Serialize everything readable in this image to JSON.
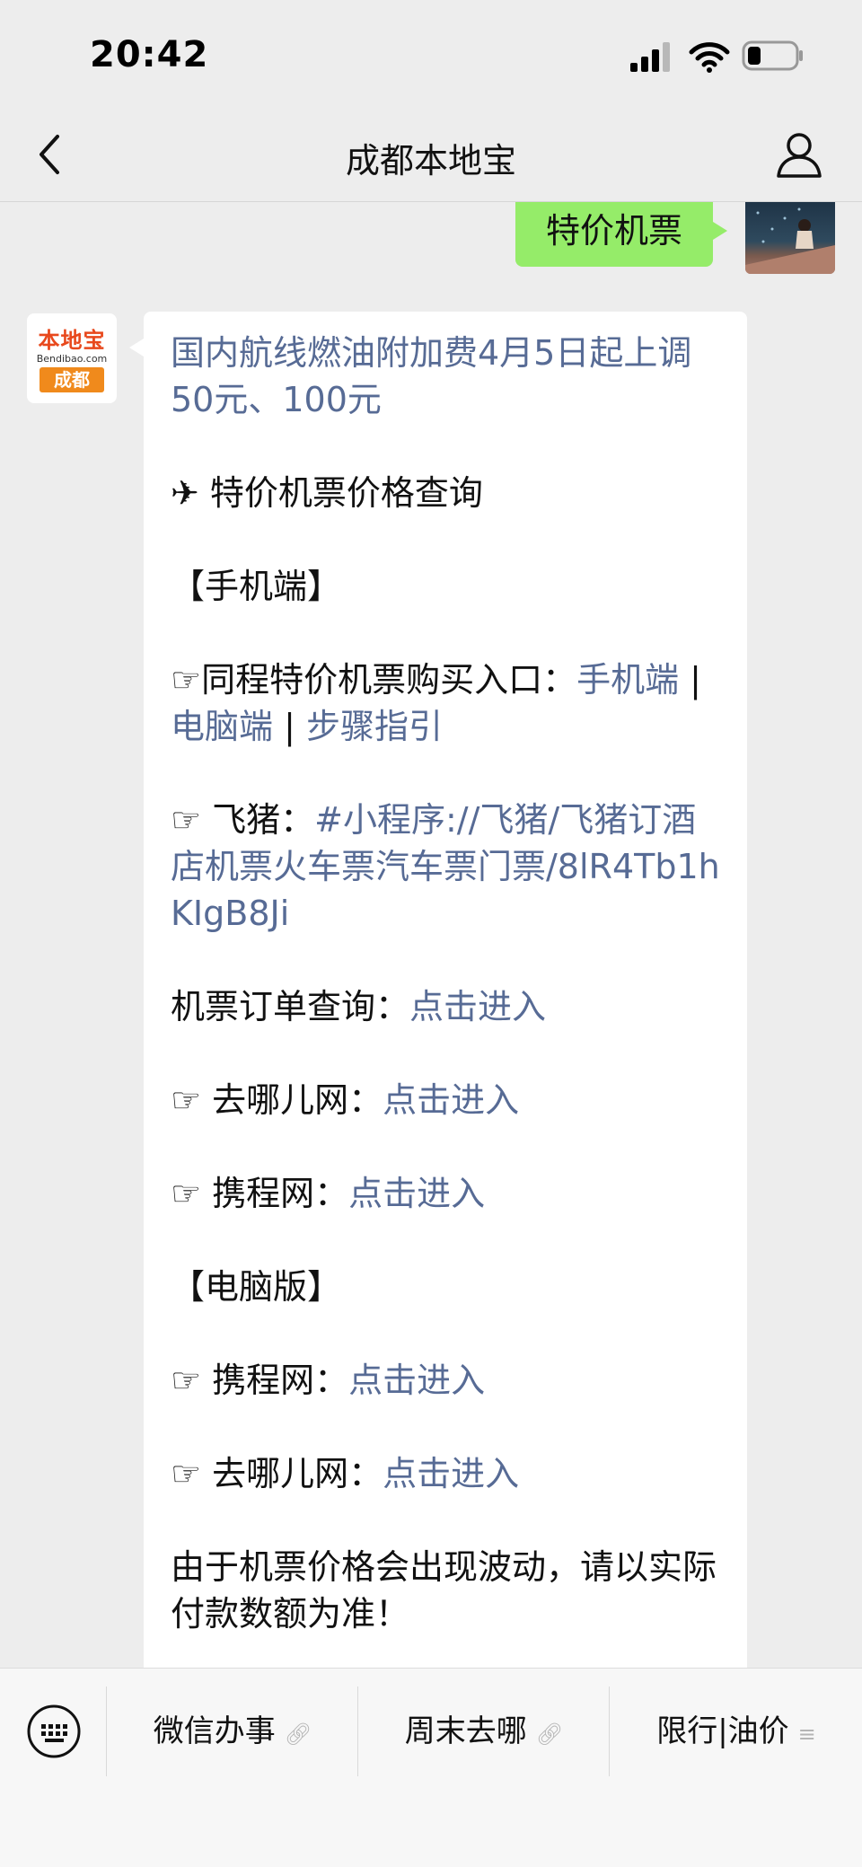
{
  "status_bar": {
    "time": "20:42"
  },
  "nav": {
    "title": "成都本地宝"
  },
  "sent_message": {
    "text": "特价机票"
  },
  "avatar_logo": {
    "top": "本地宝",
    "mid": "Bendibao.com",
    "bottom": "成都"
  },
  "message": {
    "headline": "国内航线燃油附加费4月5日起上调50元、100元",
    "query_title": "✈ 特价机票价格查询",
    "section_mobile": "【手机端】",
    "tongcheng_prefix": "☞同程特价机票购买入口：",
    "tongcheng_mobile": "手机端",
    "sep": " | ",
    "tongcheng_pc": "电脑端",
    "tongcheng_steps": "步骤指引",
    "feizhu_prefix": "☞ 飞猪：",
    "feizhu_link": "#小程序://飞猪/飞猪订酒店机票火车票汽车票门票/8lR4Tb1hKIgB8Ji",
    "order_prefix": "机票订单查询：",
    "enter": "点击进入",
    "qunar_prefix": "☞ 去哪儿网：",
    "ctrip_prefix": "☞ 携程网：",
    "section_pc": "【电脑版】",
    "note": "由于机票价格会出现波动，请以实际付款数额为准！"
  },
  "bottom_menu": [
    {
      "label": "微信办事",
      "icon": "link-icon"
    },
    {
      "label": "周末去哪",
      "icon": "link-icon"
    },
    {
      "label": "限行|油价",
      "icon": "menu-icon"
    }
  ],
  "colors": {
    "link": "#576b95",
    "sent_bubble": "#95ec69",
    "background": "#ededed"
  }
}
